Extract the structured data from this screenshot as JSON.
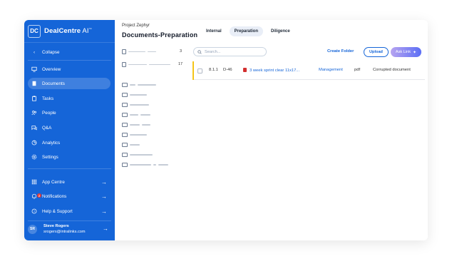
{
  "brand": {
    "logo": "DC",
    "name": "DealCentre",
    "suffix": " AI",
    "tm": "™"
  },
  "sidebar": {
    "collapse": "Collapse",
    "items": [
      {
        "label": "Overview",
        "icon": "monitor-icon"
      },
      {
        "label": "Documents",
        "icon": "document-icon",
        "active": true
      },
      {
        "label": "Tasks",
        "icon": "clipboard-icon"
      },
      {
        "label": "People",
        "icon": "people-icon"
      },
      {
        "label": "Q&A",
        "icon": "chat-icon"
      },
      {
        "label": "Analytics",
        "icon": "chart-icon"
      },
      {
        "label": "Settings",
        "icon": "gear-icon"
      }
    ],
    "bottom": [
      {
        "label": "App Centre",
        "icon": "grid-icon"
      },
      {
        "label": "Notifications",
        "icon": "bell-icon",
        "badge": "2"
      },
      {
        "label": "Help & Support",
        "icon": "help-icon"
      }
    ],
    "user": {
      "initials": "SR",
      "name": "Steve Rogers",
      "email": "srogers@intralinks.com"
    }
  },
  "header": {
    "breadcrumb": "Project Zephyr",
    "title": "Documents-Preparation",
    "tabs": [
      {
        "label": "Internal"
      },
      {
        "label": "Preparation",
        "active": true
      },
      {
        "label": "Diligence"
      }
    ]
  },
  "folder_panel": {
    "counts": [
      "3",
      "17"
    ]
  },
  "toolbar": {
    "search_placeholder": "Search...",
    "create_folder": "Create Folder",
    "upload": "Upload",
    "ask_link": "Ask Link"
  },
  "documents": [
    {
      "index": "8.1.1",
      "id": "D-46",
      "name": "3 week sprint clear 11x17...",
      "category": "Management",
      "type": "pdf",
      "status": "Corrupted document"
    }
  ]
}
